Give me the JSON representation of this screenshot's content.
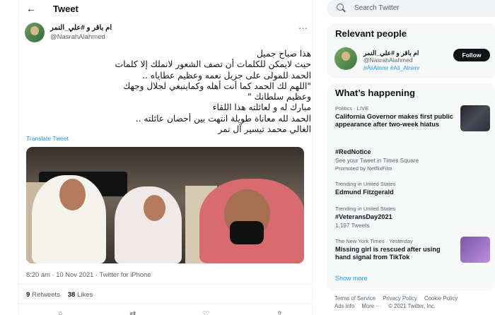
{
  "header": {
    "back_icon": "left-arrow-icon",
    "title": "Tweet"
  },
  "tweet": {
    "author_name": "ام باقر و #علي_النمر",
    "author_handle": "@NasrahAlahmed",
    "body_lines": [
      "هذا صباح جميل",
      "حيث لايمكن للكلمات أن تصف الشعور لانملك إلا كلمات",
      "الحمد للمولى على جزيل نعمه وعظيم عطاياه ..",
      "\"اللهم لك الحمد كما أنت أهله وكماينبغي لجلال وجهك",
      "وعظيم سلطانك \"",
      "مبارك له و لعائلته هذا اللقاء",
      "الحمد لله معاناة طويلة انتهت بين أحضان عائلته ..",
      "الغالي محمد تيسير آل نمر"
    ],
    "translate": "Translate Tweet",
    "timestamp": "8:20 am · 10 Nov 2021 · Twitter for iPhone",
    "retweets_count": "9",
    "retweets_label": "Retweets",
    "likes_count": "38",
    "likes_label": "Likes"
  },
  "sidebar": {
    "search_placeholder": "Search Twitter",
    "relevant": {
      "title": "Relevant people",
      "name": "ام باقر و #علي_النمر",
      "handle": "@NasrahAlahmed",
      "tags": "#AliAlnmr #Ali_Alnimr",
      "follow": "Follow"
    },
    "happening": {
      "title": "What’s happening",
      "items": [
        {
          "kicker": "Politics · LIVE",
          "title": "California Governor makes first public appearance after two-week hiatus"
        },
        {
          "title": "#RedNotice",
          "sub": "See your Tweet in Times Square",
          "promo": "Promoted by NetflixFilm"
        },
        {
          "kicker": "Trending in United States",
          "title": "Edmund Fitzgerald"
        },
        {
          "kicker": "Trending in United States",
          "title": "#VeteransDay2021",
          "sub": "1,197 Tweets"
        },
        {
          "kicker": "The New York Times · Yesterday",
          "title": "Missing girl is rescued after using hand signal from TikTok"
        }
      ],
      "show_more": "Show more"
    },
    "footer": [
      "Terms of Service",
      "Privacy Policy",
      "Cookie Policy",
      "Ads info",
      "More ···",
      "© 2021 Twitter, Inc."
    ]
  }
}
